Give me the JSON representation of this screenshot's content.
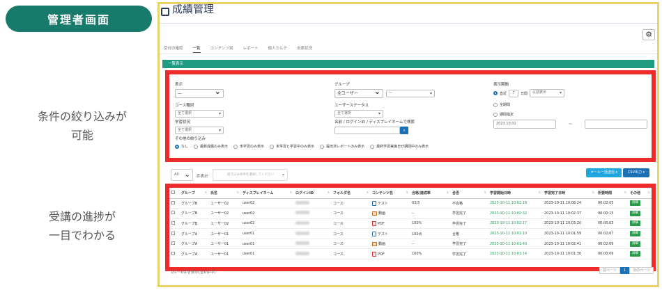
{
  "badge": "管理者画面",
  "captions": {
    "filter": [
      "条件の絞り込みが",
      "可能"
    ],
    "progress": [
      "受講の進捗が",
      "一目でわかる"
    ]
  },
  "app": {
    "title": "成績管理",
    "tabs": [
      "受付の確認",
      "一覧",
      "コンテンツ別",
      "レポート",
      "個人カルテ",
      "出席状況"
    ],
    "active_tab": 1,
    "section_title": "一覧表示"
  },
  "filters": {
    "display_label": "表示",
    "display_value": "—",
    "group_label": "グループ",
    "group_value1": "全ユーザー",
    "group_value2": "—",
    "period_label": "表示期間",
    "period_recent_label": "直近",
    "period_recent_value": "7",
    "period_unit": "日間",
    "period_unit_select": "以前表示",
    "period_all_label": "全期間",
    "period_range_label": "期間指定",
    "period_from": "2023.10.01",
    "period_sep": "〜",
    "period_to": "",
    "course_type_label": "コース種別",
    "course_type_value": "全て選択",
    "user_status_label": "ユーザーステータス",
    "user_status_value": "全て選択",
    "study_status_label": "学習状況",
    "study_status_value": "全て選択",
    "name_search_label": "名前 / ログインID / ディスプレイネームで検索",
    "name_search_value": "",
    "other_label": "その他の絞り込み",
    "other_options": [
      "なし",
      "最新成績のみ表示",
      "未学習のみ表示",
      "未学習と学習中のみ表示",
      "提出済レポートのみ表示",
      "最終学習実施日が期間中のみ表示"
    ],
    "other_selected": 0
  },
  "toolbar": {
    "page_size": "All",
    "page_size_label": "件表示",
    "search_placeholder": "絞り込み条件を選択してください",
    "mail_button": "メール一括送信 ▾",
    "csv_button": "CSV出力 ▾"
  },
  "table": {
    "columns": [
      "",
      "グループ",
      "氏名",
      "ディスプレイネーム",
      "ログインID",
      "フォルダ名",
      "コンテンツ名",
      "合格/達成率",
      "合否",
      "学習開始日時",
      "学習完了日時",
      "所要時間",
      "その他"
    ],
    "rows": [
      {
        "group": "グループB",
        "name": "ユーザー02",
        "display": "user02",
        "folder": "コース",
        "ctype": "test",
        "content": "テスト",
        "rate": "03/3",
        "result": "不合格",
        "start": "2023-10-11 10:02:18",
        "end": "2023-10-11 10:08:24",
        "time": "00:02:05",
        "btn": "詳細"
      },
      {
        "group": "グループB",
        "name": "ユーザー02",
        "display": "user02",
        "folder": "コース",
        "ctype": "video",
        "content": "動画",
        "rate": "--",
        "result": "学習完了",
        "start": "2023-10-11 10:02:32",
        "end": "2023-10-11 10:02:37",
        "time": "00:00:15",
        "btn": "詳細"
      },
      {
        "group": "グループB",
        "name": "ユーザー02",
        "display": "user02",
        "folder": "コース",
        "ctype": "pdf",
        "content": "PDF",
        "rate": "100%",
        "result": "学習完了",
        "start": "2023-10-11 10:02:17",
        "end": "2023-10-11 10:03:20",
        "time": "00:00:03",
        "btn": "詳細"
      },
      {
        "group": "グループA",
        "name": "ユーザー01",
        "display": "user01",
        "folder": "コース",
        "ctype": "test",
        "content": "テスト",
        "rate": "100点",
        "result": "合格",
        "start": "2023-10-11 10:01:10",
        "end": "2023-10-11 10:01:59",
        "time": "00:02:07",
        "btn": "詳細"
      },
      {
        "group": "グループA",
        "name": "ユーザー01",
        "display": "user01",
        "folder": "コース",
        "ctype": "video",
        "content": "動画",
        "rate": "--",
        "result": "学習完了",
        "start": "2023-10-11 10:01:40",
        "end": "2023-10-11 10:02:41",
        "time": "00:02:09",
        "btn": "詳細"
      },
      {
        "group": "グループA",
        "name": "ユーザー01",
        "display": "user01",
        "folder": "コース",
        "ctype": "pdf",
        "content": "PDF",
        "rate": "100%",
        "result": "学習完了",
        "start": "2023-10-11 10:01:14",
        "end": "2023-10-11 10:01:30",
        "time": "00:00:09",
        "btn": "詳細"
      }
    ]
  },
  "footer": {
    "summary": "1件～6件を表示(全6件中)",
    "prev": "前ページ",
    "page": "1",
    "next": "次のページ"
  },
  "colors": {
    "badge": "#187a6a",
    "section_bar": "#1f9b82",
    "highlight": "#ee2b2b",
    "frame": "#e8d36a",
    "primary": "#1a6fb5",
    "mail": "#1fa6dd"
  }
}
